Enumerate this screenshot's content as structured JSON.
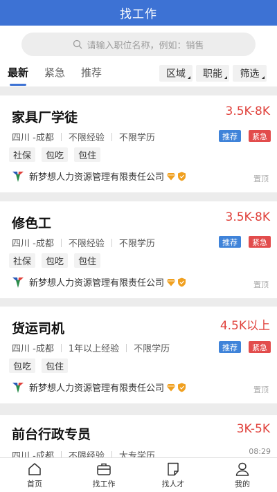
{
  "header": {
    "title": "找工作"
  },
  "search": {
    "placeholder": "请输入职位名称，例如：销售"
  },
  "tabs": [
    {
      "label": "最新",
      "active": true
    },
    {
      "label": "紧急",
      "active": false
    },
    {
      "label": "推荐",
      "active": false
    }
  ],
  "filters": [
    {
      "label": "区域"
    },
    {
      "label": "职能"
    },
    {
      "label": "筛选"
    }
  ],
  "jobs": [
    {
      "title": "家具厂学徒",
      "salary": "3.5K-8K",
      "location": "四川 -成都",
      "experience": "不限经验",
      "education": "不限学历",
      "badges": [
        "推荐",
        "紧急"
      ],
      "tags": [
        "社保",
        "包吃",
        "包住"
      ],
      "company": "新梦想人力资源管理有限责任公司",
      "pin_label": "置顶"
    },
    {
      "title": "修色工",
      "salary": "3.5K-8K",
      "location": "四川 -成都",
      "experience": "不限经验",
      "education": "不限学历",
      "badges": [
        "推荐",
        "紧急"
      ],
      "tags": [
        "社保",
        "包吃",
        "包住"
      ],
      "company": "新梦想人力资源管理有限责任公司",
      "pin_label": "置顶"
    },
    {
      "title": "货运司机",
      "salary": "4.5K以上",
      "location": "四川 -成都",
      "experience": "1年以上经验",
      "education": "不限学历",
      "badges": [
        "推荐",
        "紧急"
      ],
      "tags": [
        "包吃",
        "包住"
      ],
      "company": "新梦想人力资源管理有限责任公司",
      "pin_label": "置顶"
    },
    {
      "title": "前台行政专员",
      "salary": "3K-5K",
      "location": "四川 -成都",
      "experience": "不限经验",
      "education": "大专学历",
      "time": "08:29"
    }
  ],
  "bottom_nav": [
    {
      "label": "首页",
      "icon": "home-icon"
    },
    {
      "label": "找工作",
      "icon": "briefcase-icon"
    },
    {
      "label": "找人才",
      "icon": "document-icon"
    },
    {
      "label": "我的",
      "icon": "user-icon"
    }
  ],
  "colors": {
    "brand": "#3d72d4",
    "salary": "#e0423c",
    "badge_recommend": "#3f83d9",
    "badge_urgent": "#e24c4c"
  }
}
